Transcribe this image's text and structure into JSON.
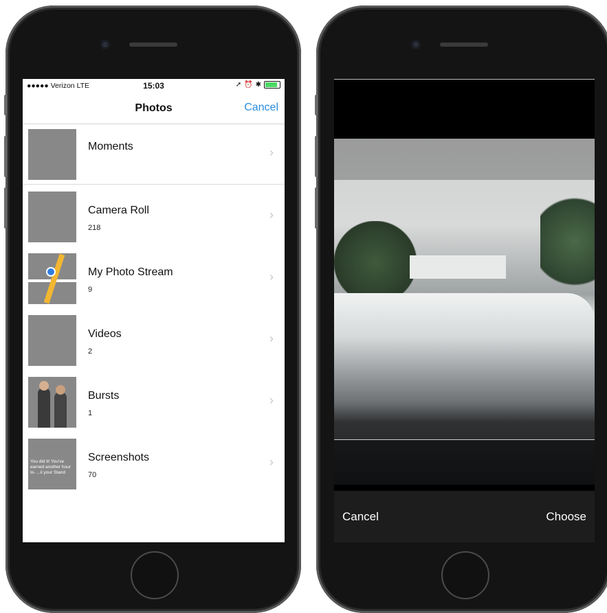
{
  "left_phone": {
    "status": {
      "carrier": "●●●●● Verizon  LTE",
      "time": "15:03"
    },
    "nav": {
      "title": "Photos",
      "cancel": "Cancel"
    },
    "albums": [
      {
        "title": "Moments",
        "count": ""
      },
      {
        "title": "Camera Roll",
        "count": "218"
      },
      {
        "title": "My Photo Stream",
        "count": "9"
      },
      {
        "title": "Videos",
        "count": "2"
      },
      {
        "title": "Bursts",
        "count": "1"
      },
      {
        "title": "Screenshots",
        "count": "70"
      }
    ],
    "screenshot_thumb_text": "You did it! You've earned another hour to- ...il your Stand"
  },
  "right_phone": {
    "cancel": "Cancel",
    "choose": "Choose"
  },
  "colors": {
    "ios_blue": "#2b8de0",
    "chevron": "#c7c7cc",
    "battery_green": "#4cd964"
  }
}
